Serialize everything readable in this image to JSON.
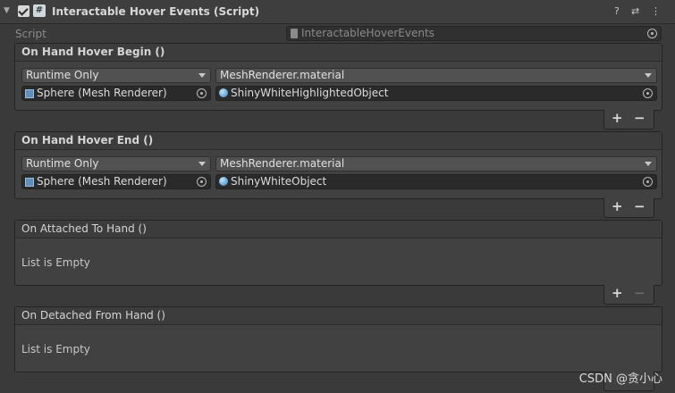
{
  "component": {
    "title": "Interactable Hover Events (Script)"
  },
  "script_row": {
    "label": "Script",
    "value": "InteractableHoverEvents"
  },
  "events": [
    {
      "title": "On Hand Hover Begin ()",
      "runtime": "Runtime Only",
      "function": "MeshRenderer.material",
      "target": "Sphere (Mesh Renderer)",
      "argument": "ShinyWhiteHighlightedObject"
    },
    {
      "title": "On Hand Hover End ()",
      "runtime": "Runtime Only",
      "function": "MeshRenderer.material",
      "target": "Sphere (Mesh Renderer)",
      "argument": "ShinyWhiteObject"
    },
    {
      "title": "On Attached To Hand ()",
      "empty_text": "List is Empty"
    },
    {
      "title": "On Detached From Hand ()",
      "empty_text": "List is Empty"
    }
  ],
  "buttons": {
    "add": "+",
    "remove": "−"
  },
  "header_icons": {
    "help": "?",
    "presets": "⇄",
    "menu": "⋮"
  },
  "watermark": "CSDN @贪小心",
  "icons": [
    "fold-arrow-icon",
    "toggle-checkbox-icon",
    "script-icon",
    "help-icon",
    "presets-icon",
    "menu-icon",
    "file-icon",
    "target-picker-icon",
    "mesh-renderer-icon",
    "material-sphere-icon"
  ]
}
